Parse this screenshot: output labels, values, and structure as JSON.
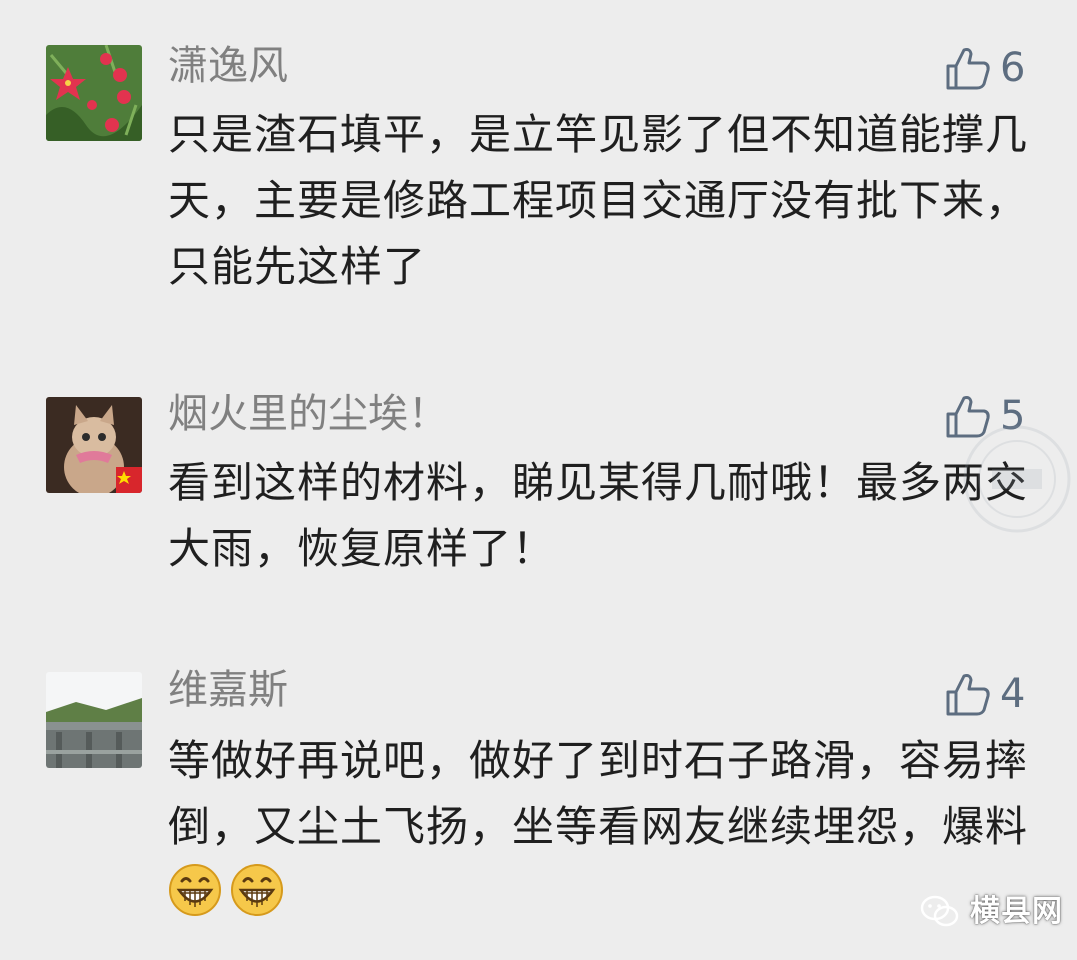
{
  "comments": [
    {
      "username": "潇逸风",
      "likes": "6",
      "text": "只是渣石填平，是立竿见影了但不知道能撑几天，主要是修路工程项目交通厅没有批下来，只能先这样了",
      "avatar_icon": "red-flower-avatar"
    },
    {
      "username": "烟火里的尘埃！",
      "likes": "5",
      "text": "看到这样的材料，睇见某得几耐哦！最多两交大雨，恢复原样了！",
      "avatar_icon": "cat-avatar"
    },
    {
      "username": "维嘉斯",
      "likes": "4",
      "text": "等做好再说吧，做好了到时石子路滑，容易摔倒，又尘土飞扬，坐等看网友继续埋怨，爆料",
      "avatar_icon": "dam-landscape-avatar",
      "emoji": [
        "grin-emoji",
        "grin-emoji"
      ]
    }
  ],
  "watermark": {
    "label": "横县网"
  },
  "colors": {
    "background": "#ededed",
    "username": "#808080",
    "text": "#1f1f1f",
    "like_icon": "#5d6d80"
  }
}
